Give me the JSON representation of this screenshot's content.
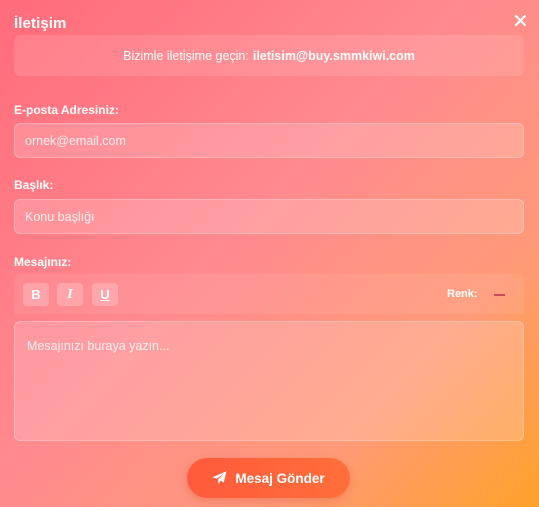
{
  "modal": {
    "title": "İletişim",
    "close_icon": "close-icon"
  },
  "contact": {
    "text": "Bizimle iletişime geçin:",
    "email": "iletisim@buy.smmkiwi.com"
  },
  "form": {
    "email_label": "E-posta Adresiniz:",
    "email_placeholder": "ornek@email.com",
    "subject_label": "Başlık:",
    "subject_placeholder": "Konu başlığı",
    "message_label": "Mesajınız:",
    "message_placeholder": "Mesajınızı buraya yazın..."
  },
  "toolbar": {
    "bold": "B",
    "italic": "I",
    "underline": "U",
    "color_label": "Renk:",
    "color_value": "#c8485f"
  },
  "submit": {
    "label": "Mesaj Gönder",
    "icon": "paper-plane-icon"
  },
  "colors": {
    "gradient_start": "#ff6b7a",
    "gradient_end": "#ffa12a",
    "button": "#ff5a3c"
  }
}
